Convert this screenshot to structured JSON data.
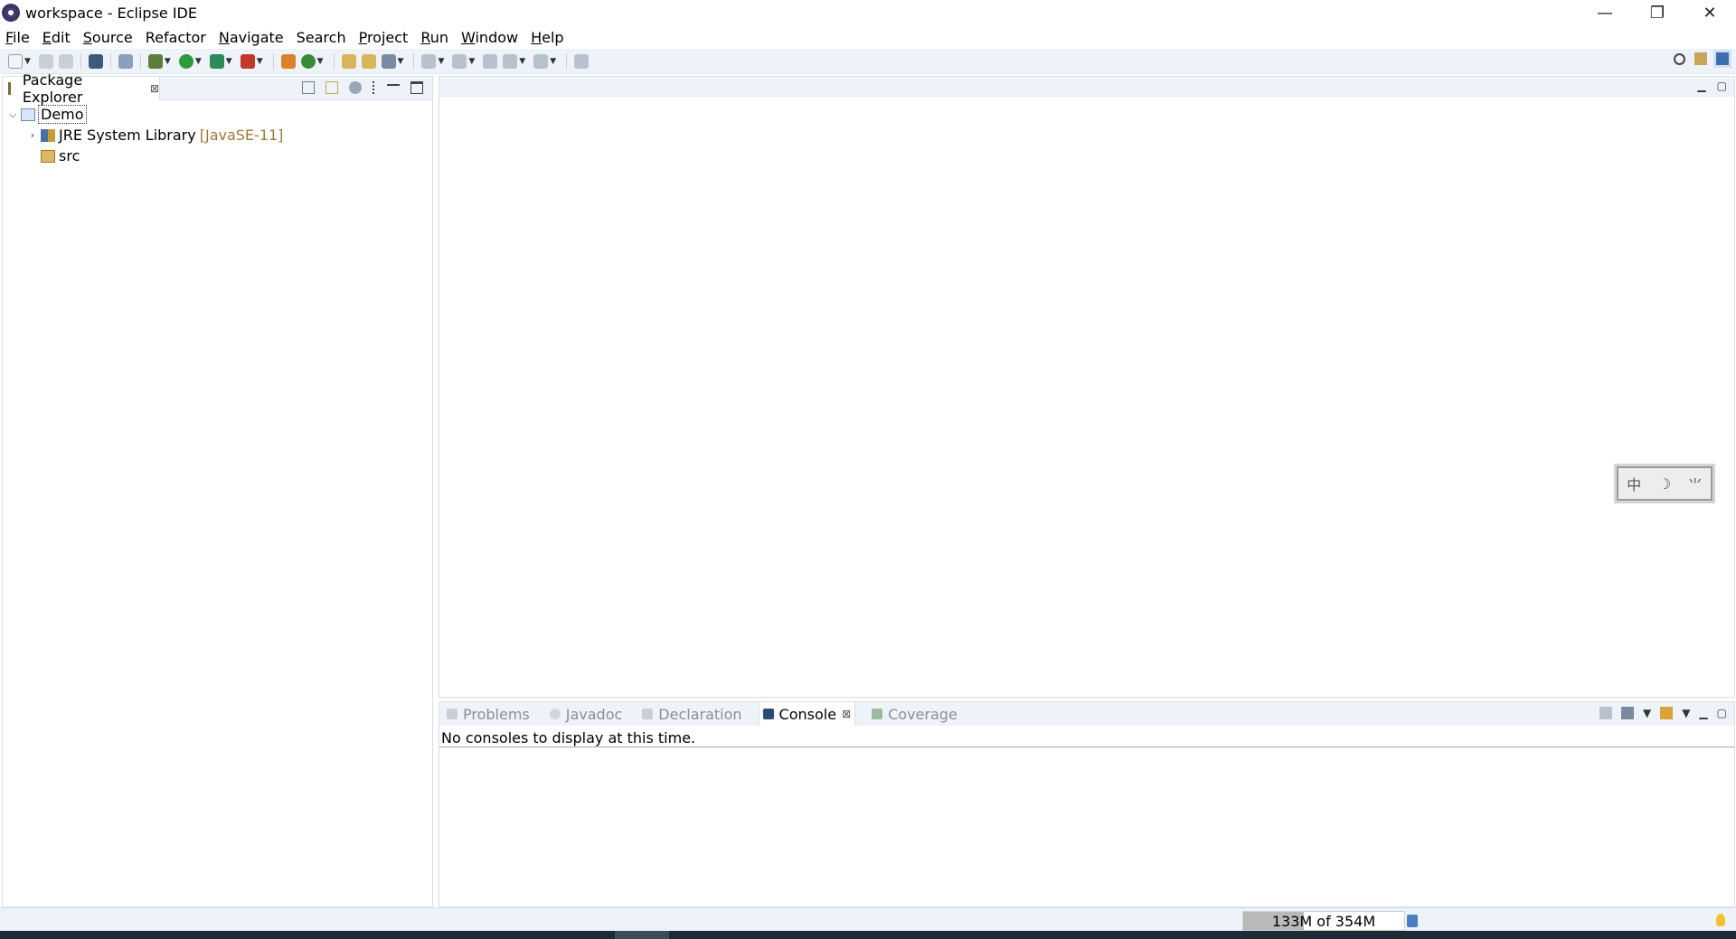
{
  "window": {
    "title": "workspace - Eclipse IDE",
    "controls": {
      "minimize": "—",
      "restore": "❐",
      "close": "✕"
    }
  },
  "menu": [
    {
      "label": "File",
      "mnemonic": "F",
      "rest": "ile"
    },
    {
      "label": "Edit",
      "mnemonic": "E",
      "rest": "dit"
    },
    {
      "label": "Source",
      "mnemonic": "S",
      "rest": "ource"
    },
    {
      "label": "Refactor",
      "mnemonic": "",
      "rest": "Refactor"
    },
    {
      "label": "Navigate",
      "mnemonic": "N",
      "rest": "avigate"
    },
    {
      "label": "Search",
      "mnemonic": "",
      "rest": "Search"
    },
    {
      "label": "Project",
      "mnemonic": "P",
      "rest": "roject"
    },
    {
      "label": "Run",
      "mnemonic": "R",
      "rest": "un"
    },
    {
      "label": "Window",
      "mnemonic": "W",
      "rest": "indow"
    },
    {
      "label": "Help",
      "mnemonic": "H",
      "rest": "elp"
    }
  ],
  "package_explorer": {
    "tab_label": "Package Explorer",
    "tree": {
      "project": "Demo",
      "jre": {
        "label": "JRE System Library",
        "decoration": "[JavaSE-11]"
      },
      "src": "src"
    }
  },
  "ime_widget": {
    "chars": [
      "中",
      "☽",
      "⺌"
    ]
  },
  "bottom_panel": {
    "tabs": [
      {
        "label": "Problems",
        "active": false
      },
      {
        "label": "Javadoc",
        "active": false
      },
      {
        "label": "Declaration",
        "active": false
      },
      {
        "label": "Console",
        "active": true
      },
      {
        "label": "Coverage",
        "active": false
      }
    ],
    "console_message": "No consoles to display at this time."
  },
  "status": {
    "heap_label": "133M of 354M",
    "heap_used_fraction": 0.376
  },
  "colors": {
    "chrome": "#eef3f9",
    "border": "#d9dfe7",
    "decoration": "#a0793a",
    "inactive_tab_text": "#8a8f96"
  }
}
